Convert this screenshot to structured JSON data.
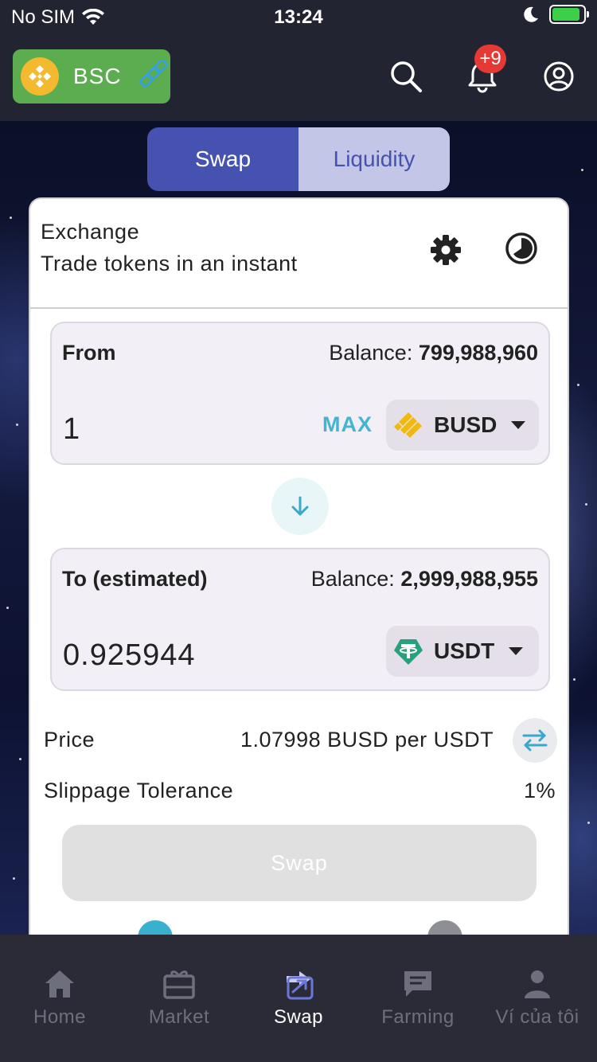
{
  "status_bar": {
    "carrier": "No SIM",
    "time": "13:24",
    "battery_level": 0.9
  },
  "app_bar": {
    "network": "BSC",
    "notification_count": "+9",
    "icons": [
      "bnb-logo",
      "chain-link-icon",
      "search-icon",
      "bell-icon",
      "account-icon"
    ]
  },
  "segmented": {
    "swap": "Swap",
    "liquidity": "Liquidity"
  },
  "exchange": {
    "title": "Exchange",
    "subtitle": "Trade tokens in an instant"
  },
  "from": {
    "label": "From",
    "balance_label": "Balance:",
    "balance_value": "799,988,960",
    "amount": "1",
    "max_label": "MAX",
    "token": "BUSD"
  },
  "to": {
    "label": "To (estimated)",
    "balance_label": "Balance:",
    "balance_value": "2,999,988,955",
    "amount": "0.925944",
    "token": "USDT"
  },
  "price": {
    "label": "Price",
    "value": "1.07998 BUSD per USDT"
  },
  "slippage": {
    "label": "Slippage Tolerance",
    "value": "1%"
  },
  "swap_button": "Swap",
  "colors": {
    "accent": "#4552b0",
    "accent_light": "#c3c6e6",
    "max": "#44b5d0",
    "network_chip": "#5cad4f",
    "badge": "#e53935"
  },
  "tabs": [
    {
      "label": "Home",
      "icon": "home-icon"
    },
    {
      "label": "Market",
      "icon": "market-icon"
    },
    {
      "label": "Swap",
      "icon": "swap-icon",
      "active": true
    },
    {
      "label": "Farming",
      "icon": "farming-icon"
    },
    {
      "label": "Ví của tôi",
      "icon": "wallet-user-icon"
    }
  ]
}
